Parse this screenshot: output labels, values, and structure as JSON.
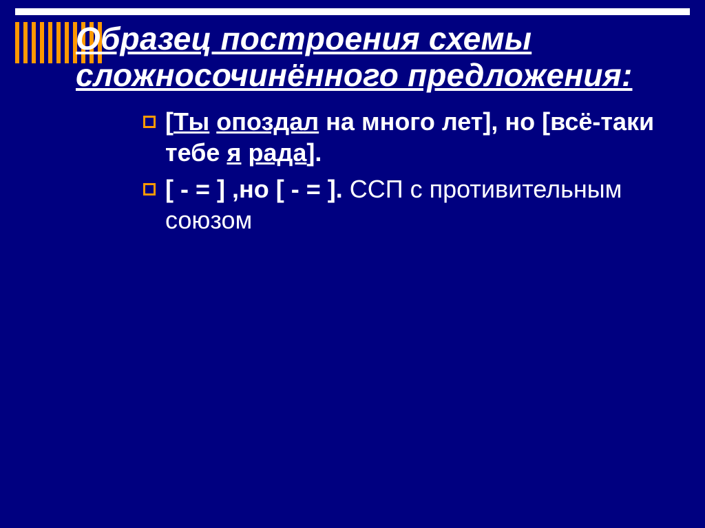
{
  "title": "Образец  построения схемы сложносочинённого предложения:",
  "bullets": [
    {
      "parts": [
        {
          "text": "[",
          "bold": true
        },
        {
          "text": "Ты",
          "bold": true,
          "underline": true
        },
        {
          "text": " ",
          "bold": true
        },
        {
          "text": "опоздал",
          "bold": true,
          "underline": true
        },
        {
          "text": " на много лет], но [всё-таки тебе ",
          "bold": true
        },
        {
          "text": "я",
          "bold": true,
          "underline": true
        },
        {
          "text": " ",
          "bold": true
        },
        {
          "text": "рада",
          "bold": true,
          "underline": true
        },
        {
          "text": "].",
          "bold": true
        }
      ]
    },
    {
      "parts": [
        {
          "text": "[ - =   ] ,но [ - =   ].",
          "bold": true
        },
        {
          "text": " ССП с противительным союзом"
        }
      ]
    }
  ]
}
